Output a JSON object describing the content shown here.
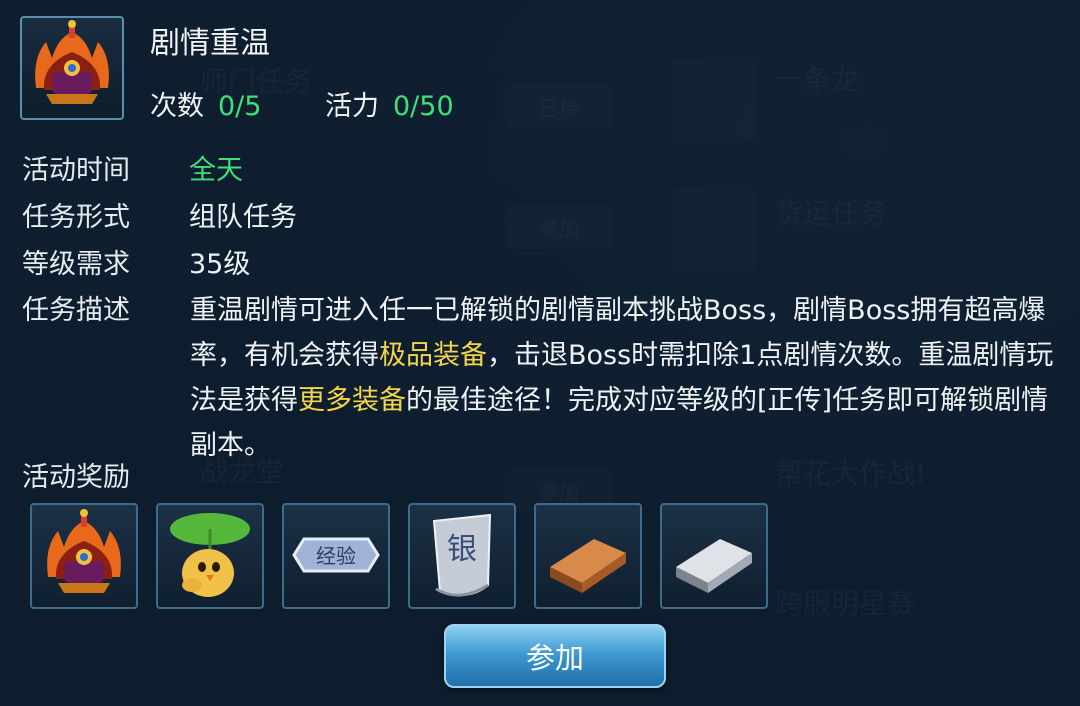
{
  "activity": {
    "title": "剧情重温",
    "count_label": "次数",
    "count_value": "0/5",
    "vitality_label": "活力",
    "vitality_value": "0/50"
  },
  "details": {
    "time_label": "活动时间",
    "time_value": "全天",
    "form_label": "任务形式",
    "form_value": "组队任务",
    "level_label": "等级需求",
    "level_value": "35级",
    "desc_label": "任务描述",
    "desc_parts": [
      "重温剧情可进入任一已解锁的剧情副本挑战Boss，剧情Boss拥有超高爆率，有机会获得",
      "极品装备",
      "，击退Boss时需扣除1点剧情次数。重温剧情玩法是获得",
      "更多装备",
      "的最佳途径！完成对应等级的[正传]任务即可解锁剧情副本。"
    ]
  },
  "rewards": {
    "label": "活动奖励",
    "items": [
      {
        "icon": "helmet-icon"
      },
      {
        "icon": "chick-pet-icon"
      },
      {
        "icon": "exp-token-icon",
        "text": "经验"
      },
      {
        "icon": "silver-scroll-icon",
        "text": "银"
      },
      {
        "icon": "bronze-ingot-icon"
      },
      {
        "icon": "silver-ingot-icon"
      }
    ]
  },
  "join_button": "参加",
  "colors": {
    "green_value": "#3ee07a",
    "highlight": "#f3d54a",
    "button": "#3f9bd2",
    "panel": "#0e1e30"
  }
}
